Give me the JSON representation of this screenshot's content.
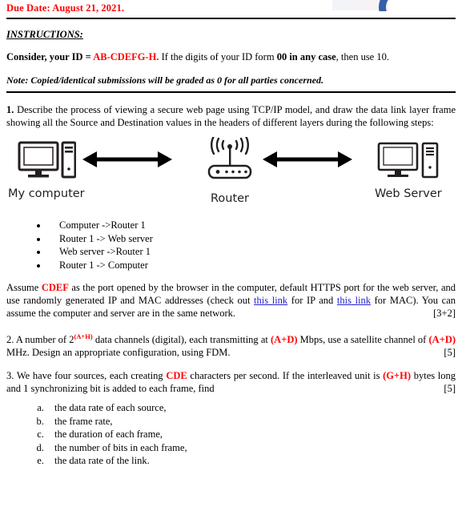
{
  "header": {
    "due_date": "Due Date: August 21, 2021.",
    "logo_color": "#2E63AE"
  },
  "instructions": {
    "heading": "INSTRUCTIONS:",
    "consider_prefix": "Consider, your ID = ",
    "consider_id": "AB-CDEFG-H.",
    "consider_mid": " If the digits of your ID form ",
    "consider_bold": "00 in any case",
    "consider_suffix": ", then use 10.",
    "note": "Note: Copied/identical submissions will be graded as 0 for all parties concerned."
  },
  "questions": [
    {
      "number": "1.",
      "text": " Describe the process of viewing a secure web page using TCP/IP model, and draw the data link layer frame showing all the Source and Destination values in the headers of different layers during the following steps:"
    }
  ],
  "diagram": {
    "nodes": [
      {
        "label": "My computer",
        "icon": "desktop-computer-icon"
      },
      {
        "label": "Router",
        "icon": "wireless-router-icon"
      },
      {
        "label": "Web Server",
        "icon": "server-computer-icon"
      }
    ],
    "arrows": [
      {
        "name": "arrow-computer-router"
      },
      {
        "name": "arrow-router-server"
      }
    ]
  },
  "steps": [
    "Computer ->Router 1",
    "Router 1 -> Web server",
    "Web server ->Router 1",
    "Router 1 -> Computer"
  ],
  "assume_paragraph": {
    "part1": "Assume ",
    "cdef": "CDEF",
    "part2": " as the port opened by the browser in the computer, default HTTPS port for the web server, and use randomly generated IP and MAC addresses (check out ",
    "link1": "this link",
    "part3": " for IP and ",
    "link2": "this link",
    "part4": " for MAC). You can assume the computer and server are in the same network.",
    "mark": "[3+2]"
  },
  "question2": {
    "number": "2.",
    "part1": " A number of 2",
    "exponent": "(A+H)",
    "part2": " data channels (digital), each transmitting at ",
    "rate": "(A+D)",
    "part3": " Mbps, use a satellite channel of ",
    "bandwidth": "(A+D)",
    "part4": " MHz. Design an appropriate configuration, using FDM.",
    "mark": "[5]"
  },
  "question3": {
    "number": "3.",
    "part1": " We have four sources, each creating ",
    "cde": "CDE",
    "part2": " characters per second. If the interleaved unit is ",
    "gh": "(G+H)",
    "part3": " bytes long and 1 synchronizing bit is added to each frame, find",
    "mark": "[5]",
    "items": [
      "the data rate of each source,",
      "the frame rate,",
      "the duration of each frame,",
      "the number of bits in each frame,",
      "the data rate of the link."
    ]
  }
}
